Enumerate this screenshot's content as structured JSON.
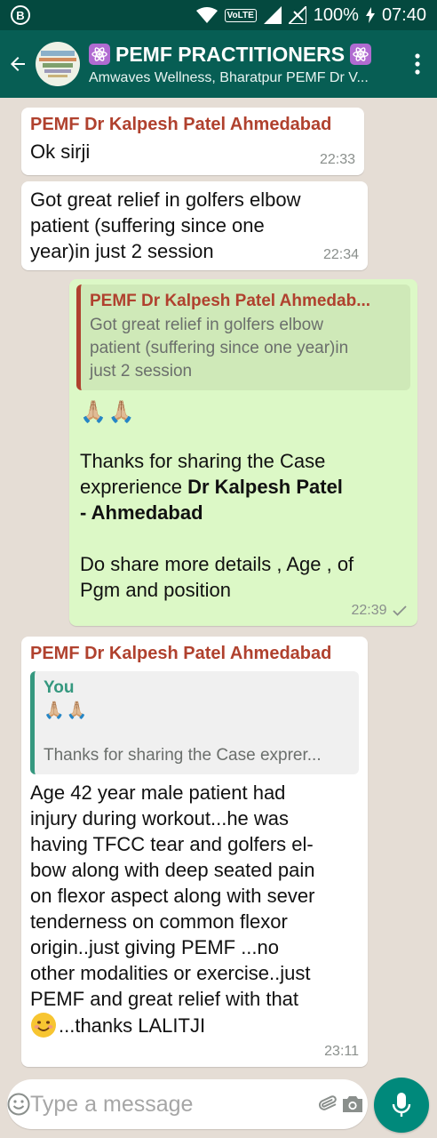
{
  "status_bar": {
    "notification_badge": "B",
    "network_label": "VoLTE",
    "battery": "100%",
    "time": "07:40"
  },
  "header": {
    "title": "PEMF PRACTITIONERS",
    "subtitle": "Amwaves Wellness, Bharatpur PEMF Dr V...",
    "accent_color": "#075e54"
  },
  "messages": [
    {
      "sender": "PEMF Dr Kalpesh Patel Ahmedabad",
      "text": "Ok sirji",
      "time": "22:33"
    },
    {
      "text_lines": [
        "Got great relief in golfers elbow",
        "patient (suffering since one",
        "year)in just 2 session"
      ],
      "time": "22:34"
    },
    {
      "quote_sender": "PEMF Dr Kalpesh Patel Ahmedab...",
      "quote_lines": [
        "Got great relief in golfers elbow",
        "patient (suffering since one year)in",
        "just 2 session"
      ],
      "hands": "🙏🏼🙏🏼",
      "thanks_line1": "Thanks for sharing the Case",
      "thanks_line2a": "exprerience ",
      "thanks_bold1": "Dr Kalpesh Patel",
      "thanks_bold2": "- Ahmedabad",
      "ask_line1": "Do share more details , Age , of",
      "ask_line2": "Pgm and position",
      "time": "22:39"
    },
    {
      "sender": "PEMF Dr Kalpesh Patel Ahmedabad",
      "quote_sender": "You",
      "quote_hands": "🙏🏼🙏🏼",
      "quote_text": "Thanks for sharing the Case exprer...",
      "text_lines": [
        "Age 42 year male patient had",
        "injury during workout...he was",
        "having TFCC tear and golfers el-",
        "bow along with deep seated pain",
        "on flexor aspect along with sever",
        "tenderness on common flexor",
        "origin..just giving PEMF ...no",
        "other modalities or exercise..just",
        "PEMF and great relief with that"
      ],
      "last_line": "...thanks LALITJI",
      "time": "23:11"
    }
  ],
  "composer": {
    "placeholder": "Type a message"
  },
  "icons": [
    "back-arrow-icon",
    "group-avatar",
    "atom-icon",
    "menu-dots-icon",
    "emoji-icon",
    "attach-icon",
    "camera-icon",
    "mic-icon",
    "read-check-icon"
  ]
}
